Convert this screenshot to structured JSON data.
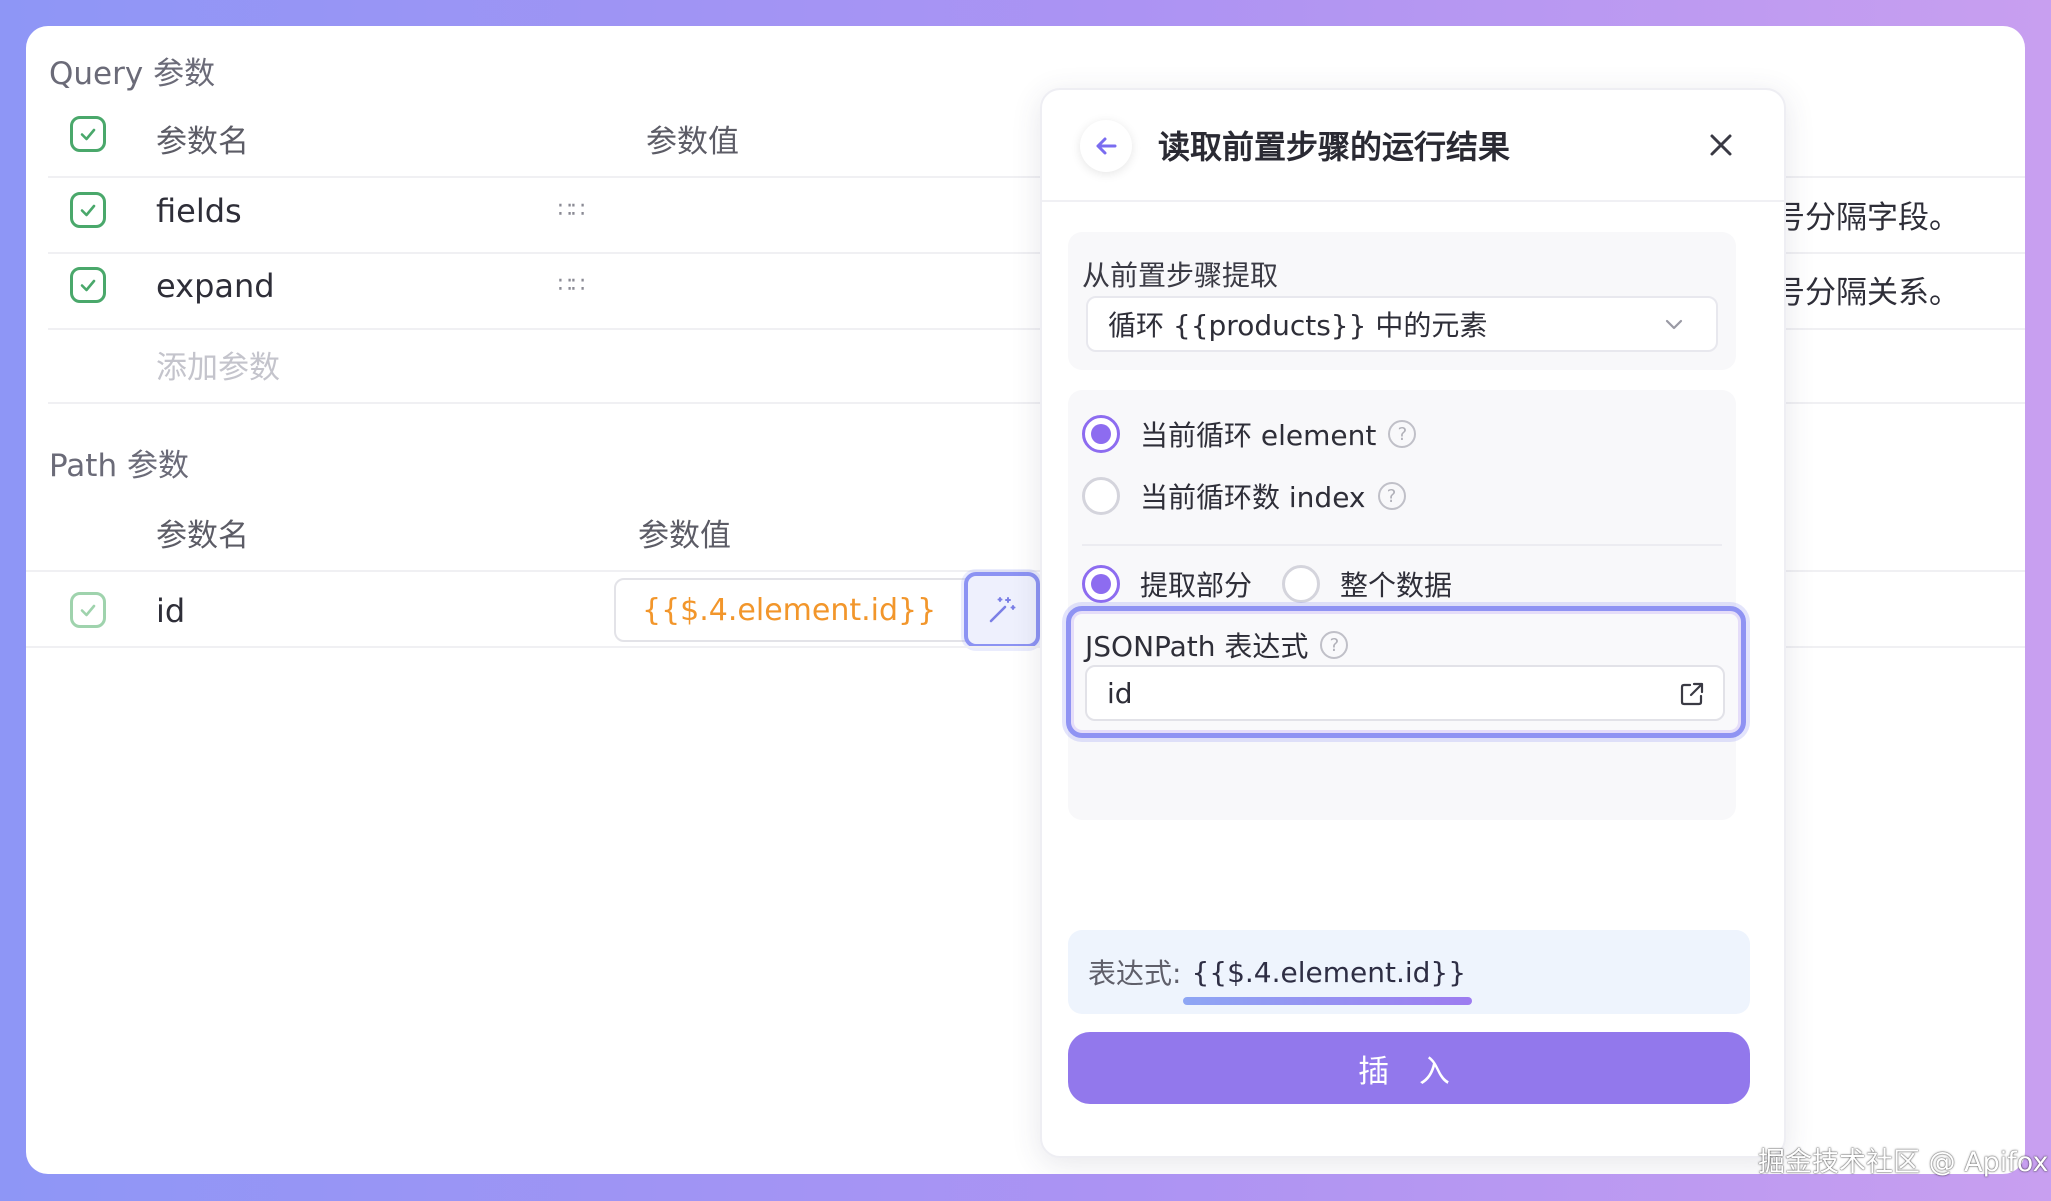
{
  "query_section": {
    "title": "Query 参数",
    "col_name": "参数名",
    "col_value": "参数值",
    "rows": [
      {
        "name": "fields",
        "right_text": "号分隔字段。"
      },
      {
        "name": "expand",
        "right_text": "号分隔关系。"
      }
    ],
    "add_param": "添加参数"
  },
  "path_section": {
    "title": "Path 参数",
    "col_name": "参数名",
    "col_value": "参数值",
    "rows": [
      {
        "name": "id",
        "value": "{{$.4.element.id}}"
      }
    ]
  },
  "panel": {
    "title": "读取前置步骤的运行结果",
    "source_label": "从前置步骤提取",
    "source_value": "循环 {{products}} 中的元素",
    "radio_element": "当前循环 element",
    "radio_index": "当前循环数 index",
    "radio_partial": "提取部分",
    "radio_whole": "整个数据",
    "jsonpath_label": "JSONPath 表达式",
    "jsonpath_value": "id",
    "expression_label": "表达式:",
    "expression_value": "{{$.4.element.id}}",
    "insert_button": "插 入"
  },
  "watermark": "掘金技术社区 @ Apifox",
  "colors": {
    "accent": "#8d6cf0",
    "check_green": "#4aa86b",
    "value_orange": "#f2962b",
    "insert_button": "#9278ec",
    "frame_gradient_start": "#8e96f6",
    "frame_gradient_end": "#c89ff0"
  }
}
